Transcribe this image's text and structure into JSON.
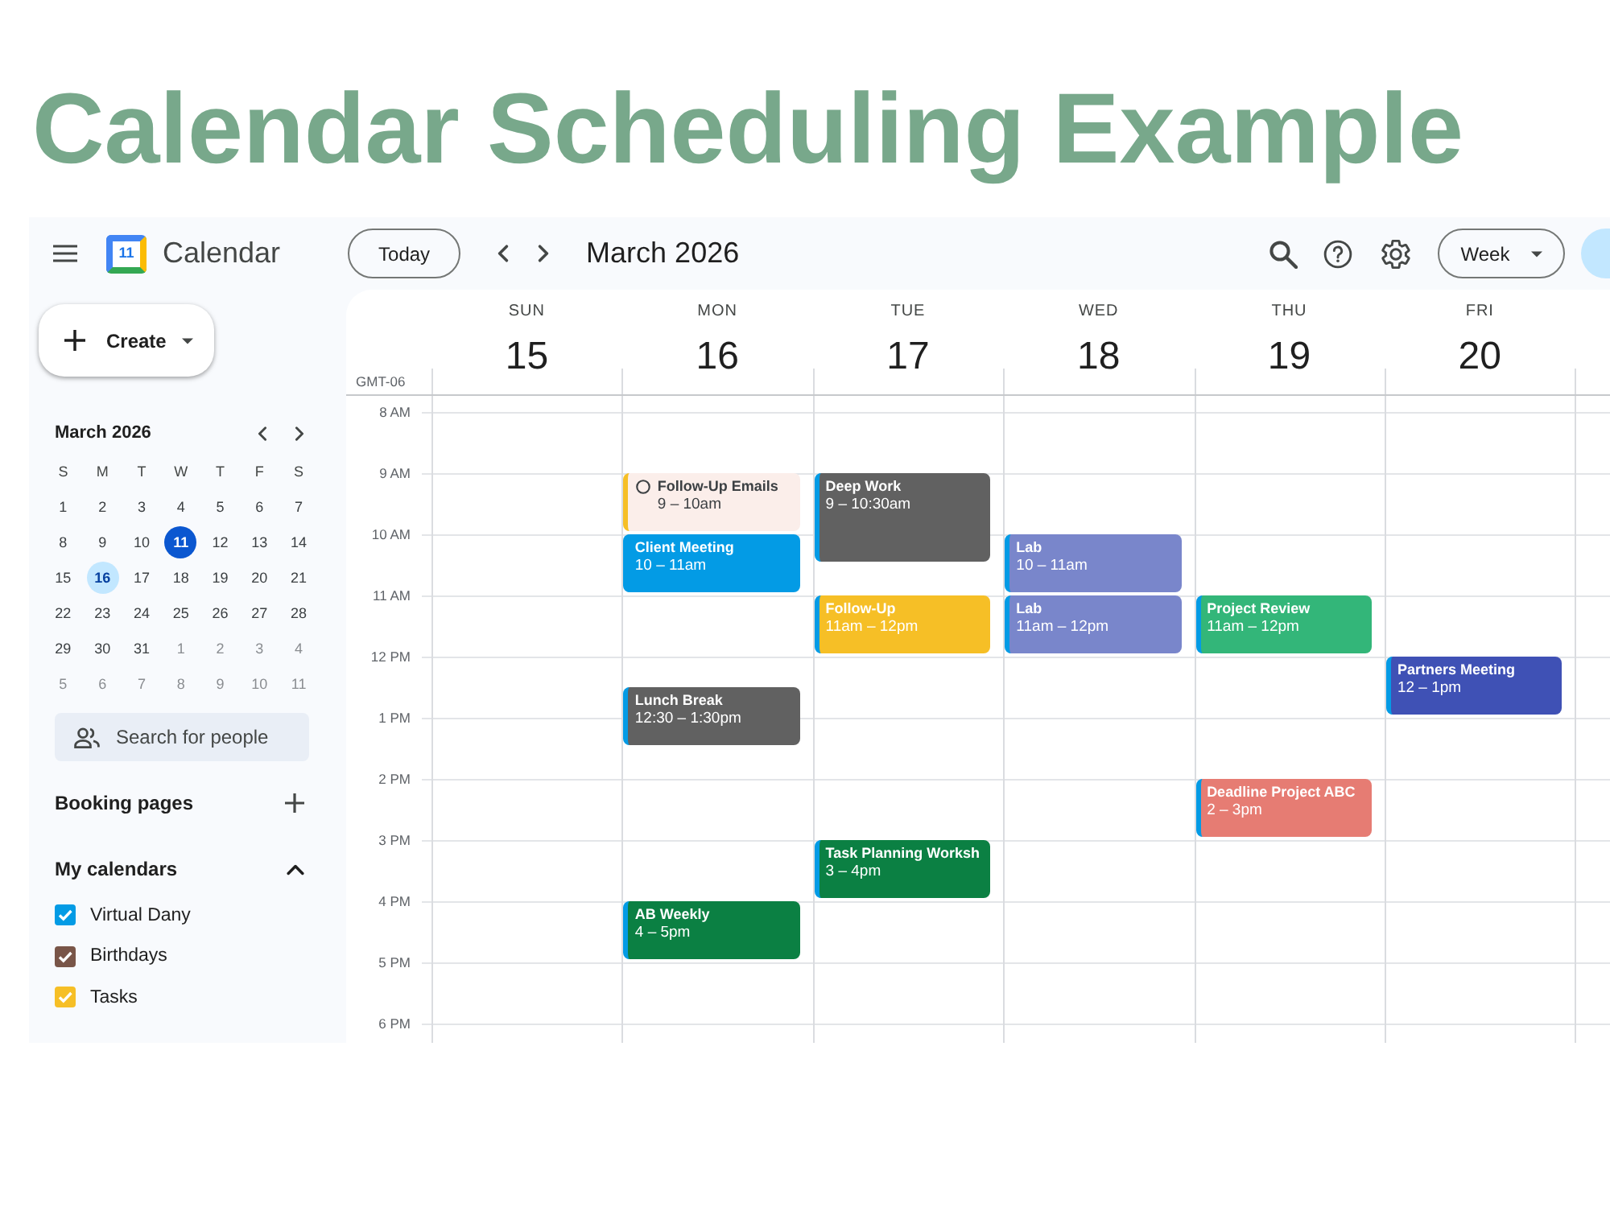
{
  "title": "Calendar Scheduling Example",
  "topbar": {
    "app_name": "Calendar",
    "logo_text": "11",
    "today_button": "Today",
    "period": "March 2026",
    "view_button": "Week"
  },
  "sidebar": {
    "create_button": "Create",
    "mini_calendar": {
      "month": "March 2026",
      "weekdays": [
        "S",
        "M",
        "T",
        "W",
        "T",
        "F",
        "S"
      ],
      "days": [
        {
          "label": "1",
          "today": false,
          "selected": false,
          "other_month": false
        },
        {
          "label": "2",
          "today": false,
          "selected": false,
          "other_month": false
        },
        {
          "label": "3",
          "today": false,
          "selected": false,
          "other_month": false
        },
        {
          "label": "4",
          "today": false,
          "selected": false,
          "other_month": false
        },
        {
          "label": "5",
          "today": false,
          "selected": false,
          "other_month": false
        },
        {
          "label": "6",
          "today": false,
          "selected": false,
          "other_month": false
        },
        {
          "label": "7",
          "today": false,
          "selected": false,
          "other_month": false
        },
        {
          "label": "8",
          "today": false,
          "selected": false,
          "other_month": false
        },
        {
          "label": "9",
          "today": false,
          "selected": false,
          "other_month": false
        },
        {
          "label": "10",
          "today": false,
          "selected": false,
          "other_month": false
        },
        {
          "label": "11",
          "today": true,
          "selected": false,
          "other_month": false
        },
        {
          "label": "12",
          "today": false,
          "selected": false,
          "other_month": false
        },
        {
          "label": "13",
          "today": false,
          "selected": false,
          "other_month": false
        },
        {
          "label": "14",
          "today": false,
          "selected": false,
          "other_month": false
        },
        {
          "label": "15",
          "today": false,
          "selected": false,
          "other_month": false
        },
        {
          "label": "16",
          "today": false,
          "selected": true,
          "other_month": false
        },
        {
          "label": "17",
          "today": false,
          "selected": false,
          "other_month": false
        },
        {
          "label": "18",
          "today": false,
          "selected": false,
          "other_month": false
        },
        {
          "label": "19",
          "today": false,
          "selected": false,
          "other_month": false
        },
        {
          "label": "20",
          "today": false,
          "selected": false,
          "other_month": false
        },
        {
          "label": "21",
          "today": false,
          "selected": false,
          "other_month": false
        },
        {
          "label": "22",
          "today": false,
          "selected": false,
          "other_month": false
        },
        {
          "label": "23",
          "today": false,
          "selected": false,
          "other_month": false
        },
        {
          "label": "24",
          "today": false,
          "selected": false,
          "other_month": false
        },
        {
          "label": "25",
          "today": false,
          "selected": false,
          "other_month": false
        },
        {
          "label": "26",
          "today": false,
          "selected": false,
          "other_month": false
        },
        {
          "label": "27",
          "today": false,
          "selected": false,
          "other_month": false
        },
        {
          "label": "28",
          "today": false,
          "selected": false,
          "other_month": false
        },
        {
          "label": "29",
          "today": false,
          "selected": false,
          "other_month": false
        },
        {
          "label": "30",
          "today": false,
          "selected": false,
          "other_month": false
        },
        {
          "label": "31",
          "today": false,
          "selected": false,
          "other_month": false
        },
        {
          "label": "1",
          "today": false,
          "selected": false,
          "other_month": true
        },
        {
          "label": "2",
          "today": false,
          "selected": false,
          "other_month": true
        },
        {
          "label": "3",
          "today": false,
          "selected": false,
          "other_month": true
        },
        {
          "label": "4",
          "today": false,
          "selected": false,
          "other_month": true
        },
        {
          "label": "5",
          "today": false,
          "selected": false,
          "other_month": true
        },
        {
          "label": "6",
          "today": false,
          "selected": false,
          "other_month": true
        },
        {
          "label": "7",
          "today": false,
          "selected": false,
          "other_month": true
        },
        {
          "label": "8",
          "today": false,
          "selected": false,
          "other_month": true
        },
        {
          "label": "9",
          "today": false,
          "selected": false,
          "other_month": true
        },
        {
          "label": "10",
          "today": false,
          "selected": false,
          "other_month": true
        },
        {
          "label": "11",
          "today": false,
          "selected": false,
          "other_month": true
        }
      ]
    },
    "search": {
      "placeholder": "Search for people"
    },
    "booking_pages": "Booking pages",
    "my_calendars": {
      "label": "My calendars",
      "expanded": true,
      "items": [
        {
          "name": "Virtual Dany",
          "checked": true,
          "color": "#039be5"
        },
        {
          "name": "Birthdays",
          "checked": true,
          "color": "#795548"
        },
        {
          "name": "Tasks",
          "checked": true,
          "color": "#f6bf26"
        }
      ]
    }
  },
  "week": {
    "timezone": "GMT-06",
    "hours": [
      "8 AM",
      "9 AM",
      "10 AM",
      "11 AM",
      "12 PM",
      "1 PM",
      "2 PM",
      "3 PM",
      "4 PM",
      "5 PM",
      "6 PM"
    ],
    "days": [
      {
        "weekday": "SUN",
        "date": "15"
      },
      {
        "weekday": "MON",
        "date": "16",
        "events": [
          {
            "kind": "task",
            "title": "Follow-Up Emails",
            "time": "9 – 10am",
            "color": "#f6bf26"
          },
          {
            "kind": "event",
            "title": "Client Meeting",
            "time": "10 – 11am",
            "color": "#039be5"
          },
          {
            "kind": "event",
            "title": "Lunch Break",
            "time": "12:30 – 1:30pm",
            "color": "#616161"
          },
          {
            "kind": "event",
            "title": "AB Weekly",
            "time": "4 – 5pm",
            "color": "#0b8043"
          }
        ]
      },
      {
        "weekday": "TUE",
        "date": "17",
        "events": [
          {
            "kind": "event",
            "title": "Deep Work",
            "time": "9 – 10:30am",
            "color": "#616161"
          },
          {
            "kind": "event",
            "title": "Follow-Up",
            "time": "11am – 12pm",
            "color": "#f6bf26"
          },
          {
            "kind": "event",
            "title": "Task Planning Worksh",
            "time": "3 – 4pm",
            "color": "#0b8043"
          }
        ]
      },
      {
        "weekday": "WED",
        "date": "18",
        "events": [
          {
            "kind": "event",
            "title": "Lab",
            "time": "10 – 11am",
            "color": "#7986cb"
          },
          {
            "kind": "event",
            "title": "Lab",
            "time": "11am – 12pm",
            "color": "#7986cb"
          }
        ]
      },
      {
        "weekday": "THU",
        "date": "19",
        "events": [
          {
            "kind": "event",
            "title": "Project Review",
            "time": "11am – 12pm",
            "color": "#33b679"
          },
          {
            "kind": "event",
            "title": "Deadline Project ABC",
            "time": "2 – 3pm",
            "color": "#e67c73"
          }
        ]
      },
      {
        "weekday": "FRI",
        "date": "20",
        "events": [
          {
            "kind": "event",
            "title": "Partners Meeting",
            "time": "12 – 1pm",
            "color": "#3f51b5"
          }
        ]
      }
    ]
  }
}
